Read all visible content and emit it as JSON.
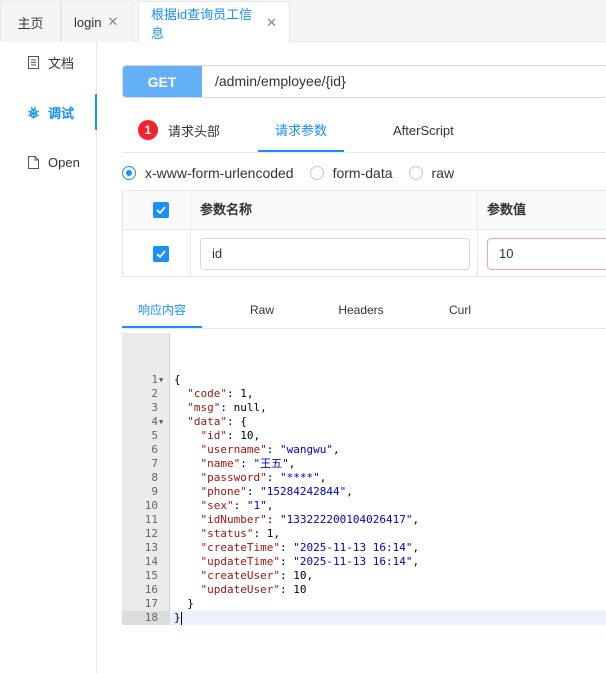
{
  "tabs": [
    {
      "label": "主页",
      "closable": false,
      "active": false
    },
    {
      "label": "login",
      "closable": true,
      "active": false
    },
    {
      "label": "根据id查询员工信息",
      "closable": true,
      "active": true
    }
  ],
  "tab_close_glyph": "✕",
  "sidebar": {
    "items": [
      {
        "label": "文档",
        "icon": "document-icon",
        "active": false
      },
      {
        "label": "调试",
        "icon": "bug-icon",
        "active": true
      },
      {
        "label": "Open",
        "icon": "file-icon",
        "active": false
      }
    ]
  },
  "request": {
    "method": "GET",
    "url": "/admin/employee/{id}",
    "tabs": [
      {
        "label": "请求头部",
        "badge": "1",
        "active": false
      },
      {
        "label": "请求参数",
        "active": true
      },
      {
        "label": "AfterScript",
        "active": false
      }
    ],
    "body_types": [
      {
        "label": "x-www-form-urlencoded",
        "selected": true
      },
      {
        "label": "form-data",
        "selected": false
      },
      {
        "label": "raw",
        "selected": false
      }
    ],
    "params_table": {
      "headers": [
        "参数名称",
        "参数值"
      ],
      "rows": [
        {
          "checked": true,
          "name": "id",
          "value": "10"
        }
      ]
    }
  },
  "response": {
    "tabs": [
      {
        "label": "响应内容",
        "active": true
      },
      {
        "label": "Raw",
        "active": false
      },
      {
        "label": "Headers",
        "active": false
      },
      {
        "label": "Curl",
        "active": false
      }
    ],
    "line_numbers": [
      "1",
      "2",
      "3",
      "4",
      "5",
      "6",
      "7",
      "8",
      "9",
      "10",
      "11",
      "12",
      "13",
      "14",
      "15",
      "16",
      "17",
      "18"
    ],
    "highlighted_line": 18,
    "code": [
      {
        "t": "{",
        "key": "",
        "val": "",
        "tail": ""
      },
      {
        "t": "  ",
        "key": "\"code\"",
        "val": "1",
        "tail": ","
      },
      {
        "t": "  ",
        "key": "\"msg\"",
        "val": "null",
        "tail": ","
      },
      {
        "t": "  ",
        "key": "\"data\"",
        "val": "{",
        "tail": ""
      },
      {
        "t": "    ",
        "key": "\"id\"",
        "val": "10",
        "tail": ","
      },
      {
        "t": "    ",
        "key": "\"username\"",
        "val": "\"wangwu\"",
        "tail": ","
      },
      {
        "t": "    ",
        "key": "\"name\"",
        "val": "\"王五\"",
        "tail": ","
      },
      {
        "t": "    ",
        "key": "\"password\"",
        "val": "\"****\"",
        "tail": ","
      },
      {
        "t": "    ",
        "key": "\"phone\"",
        "val": "\"15284242844\"",
        "tail": ","
      },
      {
        "t": "    ",
        "key": "\"sex\"",
        "val": "\"1\"",
        "tail": ","
      },
      {
        "t": "    ",
        "key": "\"idNumber\"",
        "val": "\"133222200104026417\"",
        "tail": ","
      },
      {
        "t": "    ",
        "key": "\"status\"",
        "val": "1",
        "tail": ","
      },
      {
        "t": "    ",
        "key": "\"createTime\"",
        "val": "\"2025-11-13 16:14\"",
        "tail": ","
      },
      {
        "t": "    ",
        "key": "\"updateTime\"",
        "val": "\"2025-11-13 16:14\"",
        "tail": ","
      },
      {
        "t": "    ",
        "key": "\"createUser\"",
        "val": "10",
        "tail": ","
      },
      {
        "t": "    ",
        "key": "\"updateUser\"",
        "val": "10",
        "tail": ""
      },
      {
        "t": "  }",
        "key": "",
        "val": "",
        "tail": ""
      },
      {
        "t": "}",
        "key": "",
        "val": "",
        "tail": ""
      }
    ]
  },
  "colors": {
    "accent": "#1890ff",
    "method_bg": "#63b0f7",
    "badge": "#f5222d"
  }
}
